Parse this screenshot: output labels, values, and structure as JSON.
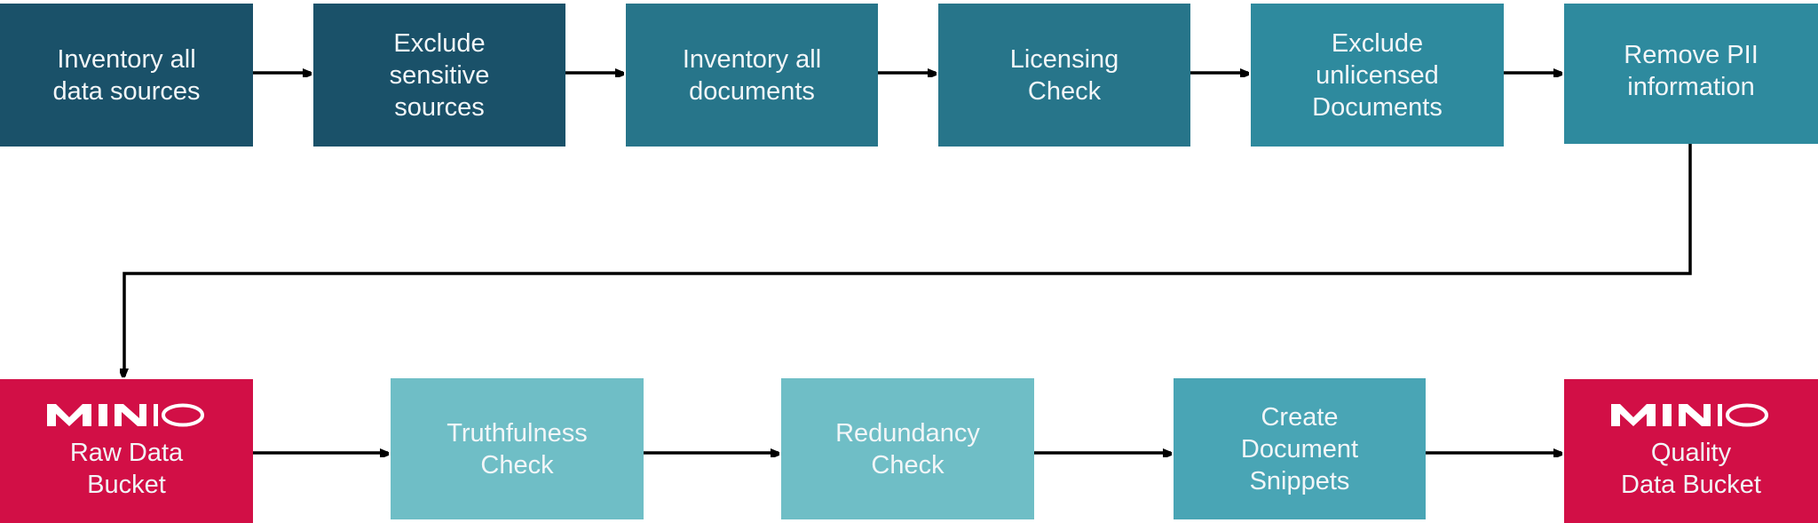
{
  "colors": {
    "dark": "#1a5169",
    "mid": "#27758a",
    "teal": "#2e8a9e",
    "light": "#6fbec6",
    "snippet": "#49a5b5",
    "minio": "#d20f46"
  },
  "top_row": [
    {
      "label": "Inventory all\ndata sources"
    },
    {
      "label": "Exclude\nsensitive\nsources"
    },
    {
      "label": "Inventory all\ndocuments"
    },
    {
      "label": "Licensing\nCheck"
    },
    {
      "label": "Exclude\nunlicensed\nDocuments"
    },
    {
      "label": "Remove PII\ninformation"
    }
  ],
  "bottom_row": [
    {
      "label": "Raw Data\nBucket",
      "logo": "MINIO"
    },
    {
      "label": "Truthfulness\nCheck"
    },
    {
      "label": "Redundancy\nCheck"
    },
    {
      "label": "Create\nDocument\nSnippets"
    },
    {
      "label": "Quality\nData Bucket",
      "logo": "MINIO"
    }
  ]
}
